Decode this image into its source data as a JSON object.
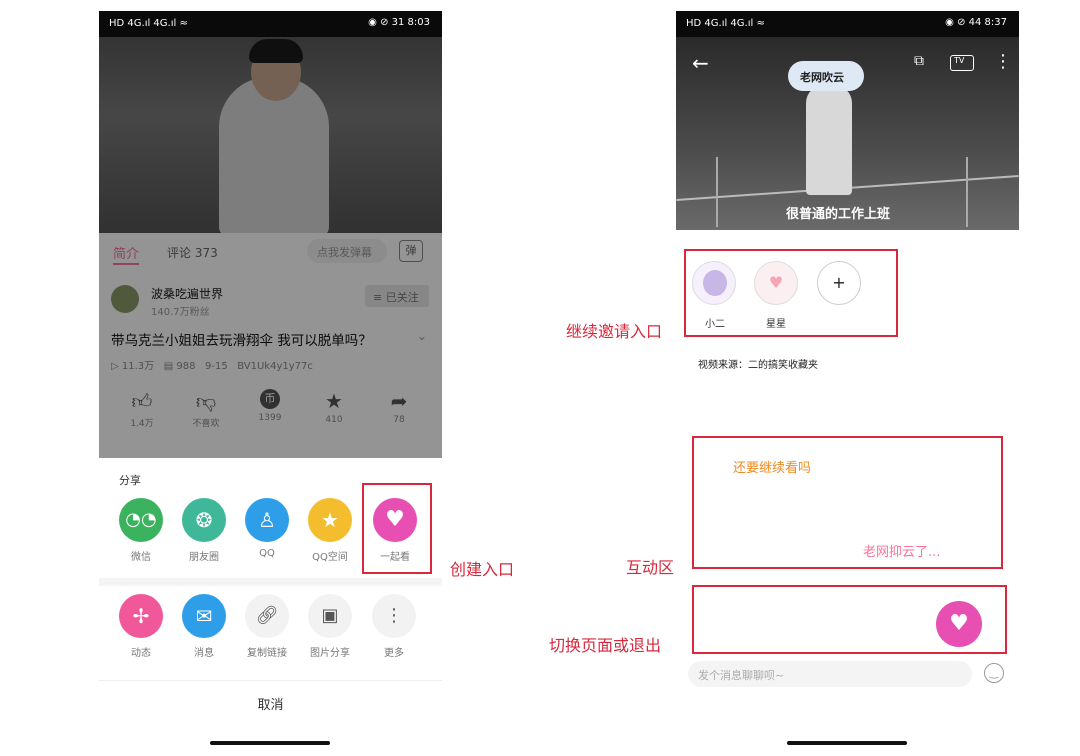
{
  "left_phone": {
    "status": {
      "left": "HD 4G.ıl 4G.ıl ≈",
      "right": "◉ ⊘ 31 8:03"
    },
    "tabs": {
      "intro": "简介",
      "comments": "评论 373",
      "danmaku_placeholder": "点我发弹幕",
      "danmaku_icon": "弹"
    },
    "uploader": {
      "name": "波桑吃遍世界",
      "followers": "140.7万粉丝",
      "follow_label": "≡ 已关注"
    },
    "video_title": "带乌克兰小姐姐去玩滑翔伞 我可以脱单吗？",
    "video_meta": {
      "views": "11.3万",
      "danmaku": "988",
      "date": "9-15",
      "bvid": "BV1Uk4y1y77c"
    },
    "actions": [
      {
        "label": "1.4万"
      },
      {
        "label": "不喜欢"
      },
      {
        "label": "1399"
      },
      {
        "label": "410"
      },
      {
        "label": "78"
      }
    ],
    "share": {
      "title": "分享",
      "row1": [
        {
          "label": "微信",
          "color": "#3bb35e"
        },
        {
          "label": "朋友圈",
          "color": "#3fb89a"
        },
        {
          "label": "QQ",
          "color": "#2f9ee8"
        },
        {
          "label": "QQ空间",
          "color": "#f3bd2e"
        },
        {
          "label": "一起看",
          "color": "#e84fb3"
        }
      ],
      "row2": [
        {
          "label": "动态",
          "color": "#f0589a"
        },
        {
          "label": "消息",
          "color": "#2f9ee8"
        },
        {
          "label": "复制链接",
          "color": "#f2f2f2"
        },
        {
          "label": "图片分享",
          "color": "#f2f2f2"
        },
        {
          "label": "更多",
          "color": "#f2f2f2"
        }
      ],
      "cancel": "取消"
    }
  },
  "right_phone": {
    "status": {
      "left": "HD 4G.ıl 4G.ıl ≈",
      "right": "◉ ⊘ 44 8:37"
    },
    "video_subtitle": "很普通的工作上班",
    "cloud_text": "老网吹云",
    "tv_label": "TV",
    "members": [
      {
        "name": "小二"
      },
      {
        "name": "星星"
      },
      {
        "name": "+"
      }
    ],
    "video_source": "视频来源：二的搞笑收藏夹",
    "chat": {
      "msg1": "还要继续看吗",
      "msg2": "老网抑云了..."
    },
    "input_placeholder": "发个消息聊聊呗~"
  },
  "annotations": {
    "create_entry": "创建入口",
    "invite_entry": "继续邀请入口",
    "interaction_area": "互动区",
    "switch_or_exit": "切换页面或退出"
  },
  "colors": {
    "accent_red": "#d9283c",
    "pink": "#fb7299",
    "orange": "#ef8a20",
    "heart": "#e84fb3"
  }
}
